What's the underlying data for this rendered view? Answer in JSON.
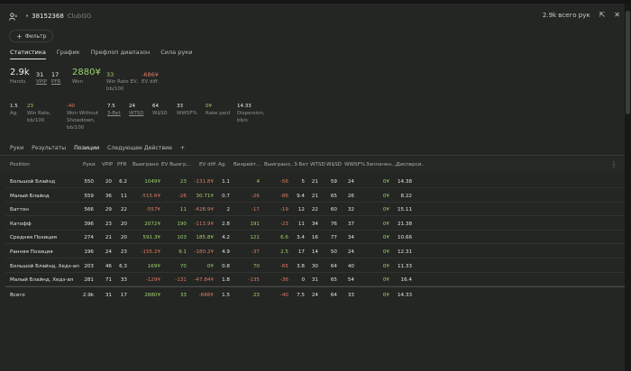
{
  "header": {
    "user_icon": "user-icon",
    "bullet": "•",
    "player_id": "38152368",
    "network": "ClubGG",
    "total_hands": "2.9k всего рук"
  },
  "filter": {
    "label": "Фильтр"
  },
  "subtabs": [
    "Статистика",
    "График",
    "Префлоп диапазон",
    "Сила руки"
  ],
  "stats_top": [
    {
      "value": "2.9k",
      "label": "Hands"
    },
    {
      "value": "31",
      "label": "VPIP"
    },
    {
      "value": "17",
      "label": "PFR"
    },
    {
      "value": "2880¥",
      "label": "Won"
    },
    {
      "value": "33",
      "label": "Win Rate EV, bb/100"
    },
    {
      "value": "-686¥",
      "label": "EV diff."
    }
  ],
  "stats_bottom": [
    {
      "value": "1.5",
      "label": "Ag."
    },
    {
      "value": "23",
      "label": "Win Rate, bb/100"
    },
    {
      "value": "-40",
      "label": "Won Without Showdown, bb/100"
    },
    {
      "value": "7.5",
      "label": "3-Bet"
    },
    {
      "value": "24",
      "label": "WTSD"
    },
    {
      "value": "64",
      "label": "W$SD"
    },
    {
      "value": "33",
      "label": "WWSF%"
    },
    {
      "value": "0¥",
      "label": "Rake paid"
    },
    {
      "value": "14.33",
      "label": "Dispersion, bb/s"
    }
  ],
  "tabs": [
    "Руки",
    "Результаты",
    "Позиции",
    "Следующее Действие",
    "+"
  ],
  "table": {
    "headers": [
      "Position",
      "Руки",
      "VPIP",
      "PFR",
      "Выиграно",
      "EV Выигр...",
      "EV diff.",
      "Ag.",
      "Винрейт...",
      "Выиграно...",
      "3-Бет",
      "WTSD",
      "W$SD",
      "WWSF%",
      "Заплачен...",
      "Дисперси..."
    ],
    "rows": [
      [
        "Большой Блайнд",
        "550",
        "20",
        "6.2",
        "1049¥",
        "23",
        "-131.8¥",
        "1.1",
        "4",
        "-56",
        "5",
        "21",
        "59",
        "24",
        "0¥",
        "14.38"
      ],
      [
        "Малый Блайнд",
        "559",
        "36",
        "11",
        "-515.6¥",
        "-26",
        "30.71¥",
        "0.7",
        "-26",
        "-86",
        "9.4",
        "21",
        "65",
        "26",
        "0¥",
        "8.22"
      ],
      [
        "Баттон",
        "566",
        "29",
        "22",
        "-557¥",
        "11",
        "-428.9¥",
        "2",
        "-17",
        "-19",
        "12",
        "22",
        "60",
        "32",
        "0¥",
        "15.11"
      ],
      [
        "Катофф",
        "396",
        "23",
        "20",
        "2072¥",
        "190",
        "-113.9¥",
        "2.8",
        "191",
        "-23",
        "11",
        "34",
        "76",
        "37",
        "0¥",
        "21.38"
      ],
      [
        "Средняя Позиция",
        "274",
        "21",
        "20",
        "591.3¥",
        "103",
        "185.8¥",
        "4.2",
        "121",
        "6.6",
        "3.4",
        "16",
        "77",
        "34",
        "0¥",
        "10.66"
      ],
      [
        "Ранняя Позиция",
        "196",
        "24",
        "23",
        "-155.2¥",
        "9.1",
        "-180.2¥",
        "4.9",
        "-37",
        "2.5",
        "17",
        "14",
        "50",
        "24",
        "0¥",
        "12.31"
      ],
      [
        "Большой Блайнд, Хедз-ап",
        "203",
        "46",
        "6.3",
        "169¥",
        "70",
        "0¥",
        "0.8",
        "70",
        "-65",
        "3.8",
        "30",
        "64",
        "40",
        "0¥",
        "11.33"
      ],
      [
        "Малый Блайнд, Хедз-ап",
        "281",
        "71",
        "33",
        "-129¥",
        "-131",
        "-47.84¥",
        "1.8",
        "-135",
        "-36",
        "0",
        "31",
        "65",
        "54",
        "0¥",
        "16.4"
      ]
    ],
    "total": [
      "Всего",
      "2.9k",
      "31",
      "17",
      "2880¥",
      "33",
      "-686¥",
      "1.5",
      "23",
      "-40",
      "7.5",
      "24",
      "64",
      "33",
      "0¥",
      "14.33"
    ]
  },
  "colors": {
    "positive": "#9fd06b",
    "negative": "#e07a62"
  }
}
